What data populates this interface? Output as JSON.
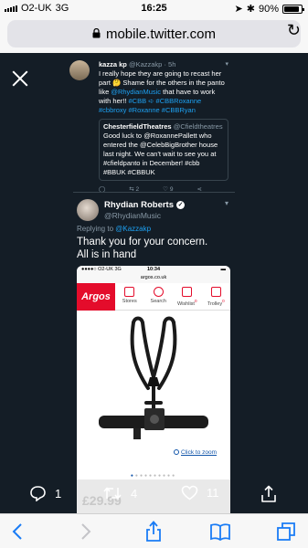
{
  "status_bar": {
    "carrier": "O2-UK",
    "network": "3G",
    "time": "16:25",
    "battery": "90%",
    "battery_level": 0.9
  },
  "browser": {
    "url": "mobile.twitter.com"
  },
  "embedded_tweet": {
    "name": "kazza kp",
    "handle": "@Kazzakp",
    "age": "· 5h",
    "text_1": "I really hope they are going to recast her part 🤔 Shame for the others in the panto like ",
    "mention": "@RhydianMusic",
    "text_2": " that have to work with her!! ",
    "hashtags": "#CBB ➪ #CBBRoxanne #cbbroxy #Roxanne #CBBRyan",
    "quote": {
      "name": "ChesterfieldTheatres",
      "handle": "@Cfieldtheatres",
      "text": "Good luck to @RoxannePallett who entered the @CelebBigBrother house last night. We can't wait to see you at #cfieldpanto in December! #cbb #BBUK #CBBUK"
    },
    "mini_counts": {
      "retweets": "2",
      "likes": "9"
    }
  },
  "tweet": {
    "author_name": "Rhydian Roberts",
    "author_handle": "@RhydianMusic",
    "replying_label": "Replying to ",
    "replying_to": "@Kazzakp",
    "line_1": "Thank you for your concern.",
    "line_2": "All is in hand"
  },
  "screenshot": {
    "carrier": "O2-UK",
    "network": "3G",
    "time": "10:34",
    "url": "argos.co.uk",
    "logo": "Argos",
    "nav": [
      "Stores",
      "Search",
      "Wishlist",
      "Trolley"
    ],
    "wishlist_count": "0",
    "trolley_count": "0",
    "zoom_label": "Click to zoom",
    "price": "£29.99"
  },
  "actions": {
    "replies": "1",
    "retweets": "4",
    "likes": "11"
  },
  "icons": [
    "close-icon",
    "verified-icon",
    "reply-icon",
    "retweet-icon",
    "like-icon",
    "share-icon",
    "back-icon",
    "forward-icon",
    "share-sheet-icon",
    "bookmarks-icon",
    "tabs-icon",
    "lock-icon",
    "reload-icon"
  ],
  "colors": {
    "viewer_bg": "#141d26",
    "link_blue": "#1da1f2",
    "ios_blue": "#1a7cf5",
    "argos_red": "#e40c2b"
  }
}
